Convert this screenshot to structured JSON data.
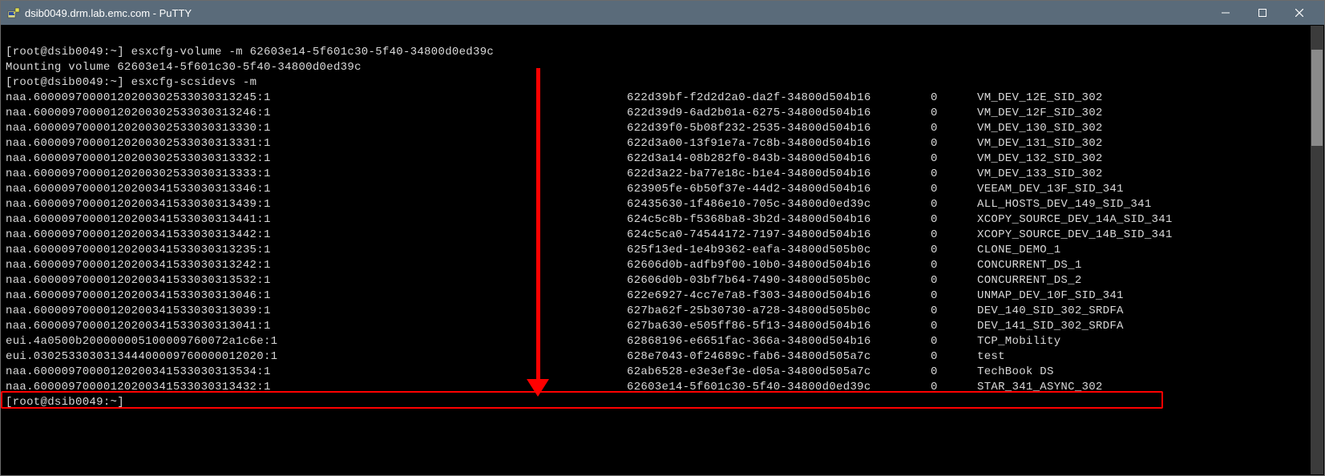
{
  "titlebar": {
    "title": "dsib0049.drm.lab.emc.com - PuTTY"
  },
  "terminal": {
    "prompt": "[root@dsib0049:~]",
    "cmd1": "esxcfg-volume -m 62603e14-5f601c30-5f40-34800d0ed39c",
    "line_mounting": "Mounting volume 62603e14-5f601c30-5f40-34800d0ed39c",
    "cmd2": "esxcfg-scsidevs -m",
    "rows": [
      {
        "dev": "naa.60000970000120200302533030313245:1",
        "uuid": "622d39bf-f2d2d2a0-da2f-34800d504b16",
        "n": "0",
        "label": "VM_DEV_12E_SID_302"
      },
      {
        "dev": "naa.60000970000120200302533030313246:1",
        "uuid": "622d39d9-6ad2b01a-6275-34800d504b16",
        "n": "0",
        "label": "VM_DEV_12F_SID_302"
      },
      {
        "dev": "naa.60000970000120200302533030313330:1",
        "uuid": "622d39f0-5b08f232-2535-34800d504b16",
        "n": "0",
        "label": "VM_DEV_130_SID_302"
      },
      {
        "dev": "naa.60000970000120200302533030313331:1",
        "uuid": "622d3a00-13f91e7a-7c8b-34800d504b16",
        "n": "0",
        "label": "VM_DEV_131_SID_302"
      },
      {
        "dev": "naa.60000970000120200302533030313332:1",
        "uuid": "622d3a14-08b282f0-843b-34800d504b16",
        "n": "0",
        "label": "VM_DEV_132_SID_302"
      },
      {
        "dev": "naa.60000970000120200302533030313333:1",
        "uuid": "622d3a22-ba77e18c-b1e4-34800d504b16",
        "n": "0",
        "label": "VM_DEV_133_SID_302"
      },
      {
        "dev": "naa.60000970000120200341533030313346:1",
        "uuid": "623905fe-6b50f37e-44d2-34800d504b16",
        "n": "0",
        "label": "VEEAM_DEV_13F_SID_341"
      },
      {
        "dev": "naa.60000970000120200341533030313439:1",
        "uuid": "62435630-1f486e10-705c-34800d0ed39c",
        "n": "0",
        "label": "ALL_HOSTS_DEV_149_SID_341"
      },
      {
        "dev": "naa.60000970000120200341533030313441:1",
        "uuid": "624c5c8b-f5368ba8-3b2d-34800d504b16",
        "n": "0",
        "label": "XCOPY_SOURCE_DEV_14A_SID_341"
      },
      {
        "dev": "naa.60000970000120200341533030313442:1",
        "uuid": "624c5ca0-74544172-7197-34800d504b16",
        "n": "0",
        "label": "XCOPY_SOURCE_DEV_14B_SID_341"
      },
      {
        "dev": "naa.60000970000120200341533030313235:1",
        "uuid": "625f13ed-1e4b9362-eafa-34800d505b0c",
        "n": "0",
        "label": "CLONE_DEMO_1"
      },
      {
        "dev": "naa.60000970000120200341533030313242:1",
        "uuid": "62606d0b-adfb9f00-10b0-34800d504b16",
        "n": "0",
        "label": "CONCURRENT_DS_1"
      },
      {
        "dev": "naa.60000970000120200341533030313532:1",
        "uuid": "62606d0b-03bf7b64-7490-34800d505b0c",
        "n": "0",
        "label": "CONCURRENT_DS_2"
      },
      {
        "dev": "naa.60000970000120200341533030313046:1",
        "uuid": "622e6927-4cc7e7a8-f303-34800d504b16",
        "n": "0",
        "label": "UNMAP_DEV_10F_SID_341"
      },
      {
        "dev": "naa.60000970000120200341533030313039:1",
        "uuid": "627ba62f-25b30730-a728-34800d505b0c",
        "n": "0",
        "label": "DEV_140_SID_302_SRDFA"
      },
      {
        "dev": "naa.60000970000120200341533030313041:1",
        "uuid": "627ba630-e505ff86-5f13-34800d504b16",
        "n": "0",
        "label": "DEV_141_SID_302_SRDFA"
      },
      {
        "dev": "eui.4a0500b200000005100009760072a1c6e:1",
        "uuid": "62868196-e6651fac-366a-34800d504b16",
        "n": "0",
        "label": "TCP_Mobility"
      },
      {
        "dev": "eui.030253303031344400009760000012020:1",
        "uuid": "628e7043-0f24689c-fab6-34800d505a7c",
        "n": "0",
        "label": "test"
      },
      {
        "dev": "naa.60000970000120200341533030313534:1",
        "uuid": "62ab6528-e3e3ef3e-d05a-34800d505a7c",
        "n": "0",
        "label": "TechBook DS"
      },
      {
        "dev": "naa.60000970000120200341533030313432:1",
        "uuid": "62603e14-5f601c30-5f40-34800d0ed39c",
        "n": "0",
        "label": "STAR_341_ASYNC_302"
      }
    ]
  }
}
